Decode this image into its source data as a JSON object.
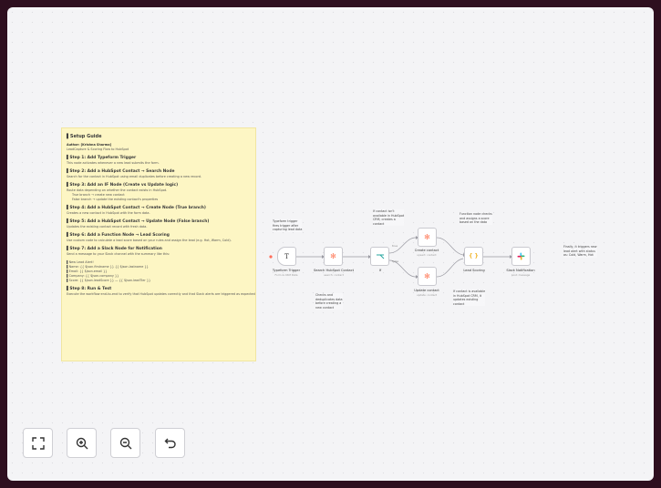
{
  "sticky": {
    "title": "Setup Guide",
    "author": "Author: [Krishna Sharma]",
    "subtitle": "LeadCapture & Scoring Flow to HubSpot",
    "steps": [
      {
        "title": "Step 1: Add Typeform Trigger",
        "desc": "This node activates whenever a new lead submits the form."
      },
      {
        "title": "Step 2: Add a HubSpot Contact → Search Node",
        "desc": "Search for the contact in HubSpot using email duplicates before creating a new record."
      },
      {
        "title": "Step 3: Add an IF Node (Create vs Update logic)",
        "desc": "Route data depending on whether the contact exists in HubSpot.",
        "extra": [
          "True branch → create new contact",
          "False branch → update the existing contact's properties"
        ]
      },
      {
        "title": "Step 4: Add a HubSpot Contact → Create Node (True branch)",
        "desc": "Creates a new contact in HubSpot with the form data."
      },
      {
        "title": "Step 5: Add a HubSpot Contact → Update Node (False branch)",
        "desc": "Updates the existing contact record with fresh data."
      },
      {
        "title": "Step 6: Add a Function Node → Lead Scoring",
        "desc": "Use custom code to calculate a lead score based on your rules and assign the lead (e.g. Hot, Warm, Cold)."
      },
      {
        "title": "Step 7: Add a Slack Node for Notification",
        "desc": "Send a message to your Slack channel with the summary like this:"
      }
    ],
    "template": [
      "New Lead Alert!",
      "Name: {{ $json.firstname }} {{ $json.lastname }}",
      "Email: {{ $json.email }}",
      "Company: {{ $json.company }}",
      "Score: {{ $json.leadScore }} — {{ $json.leadTier }}"
    ],
    "final_title": "Step 8: Run & Test",
    "final_desc": "Execute the workflow end-to-end to verify that HubSpot updates correctly and that Slack alerts are triggered as expected."
  },
  "nodes": [
    {
      "id": "typeform",
      "label": "Typeform Trigger",
      "sub": "Form & CRM Data",
      "icon": "typeform-icon"
    },
    {
      "id": "search",
      "label": "Search HubSpot Contact",
      "sub": "search: contact",
      "icon": "hubspot-icon"
    },
    {
      "id": "if",
      "label": "If",
      "sub": "",
      "icon": "if-icon"
    },
    {
      "id": "create",
      "label": "Create contact",
      "sub": "upsert: contact",
      "icon": "hubspot-icon"
    },
    {
      "id": "update",
      "label": "Update contact",
      "sub": "update: contact",
      "icon": "hubspot-icon"
    },
    {
      "id": "scoring",
      "label": "Lead Scoring",
      "sub": "",
      "icon": "code-icon"
    },
    {
      "id": "slack",
      "label": "Slack Notification",
      "sub": "post: message",
      "icon": "slack-icon"
    }
  ],
  "branch_labels": {
    "true": "true",
    "false": "false"
  },
  "notes": {
    "n1": [
      "Typeform trigger",
      "fires trigger after",
      "capturing lead data"
    ],
    "n2": [
      "Checks and",
      "deduplicates data",
      "before creating a",
      "new contact"
    ],
    "n3": [
      "If contact isn't",
      "available in HubSpot",
      "CRM, creates a",
      "contact"
    ],
    "n4": [
      "If contact is available",
      "in HubSpot CRM, it",
      "updates existing",
      "contact"
    ],
    "n5": [
      "Function node checks",
      "and assigns a score",
      "based on the data"
    ],
    "n6": [
      "Finally, it triggers new",
      "lead alert with status",
      "as: Cold, Warm, Hot"
    ]
  },
  "colors": {
    "background": "#2e0f1f",
    "canvas": "#f4f4f6",
    "sticky": "#fdf6c4",
    "hubspot": "#ff7a59",
    "edge": "#9a9aa2",
    "trigger_dot": "#ff6d5a"
  },
  "controls": [
    {
      "name": "fit-view-button",
      "icon": "fit-view-icon"
    },
    {
      "name": "zoom-in-button",
      "icon": "zoom-in-icon"
    },
    {
      "name": "zoom-out-button",
      "icon": "zoom-out-icon"
    },
    {
      "name": "reset-zoom-button",
      "icon": "undo-icon"
    }
  ]
}
